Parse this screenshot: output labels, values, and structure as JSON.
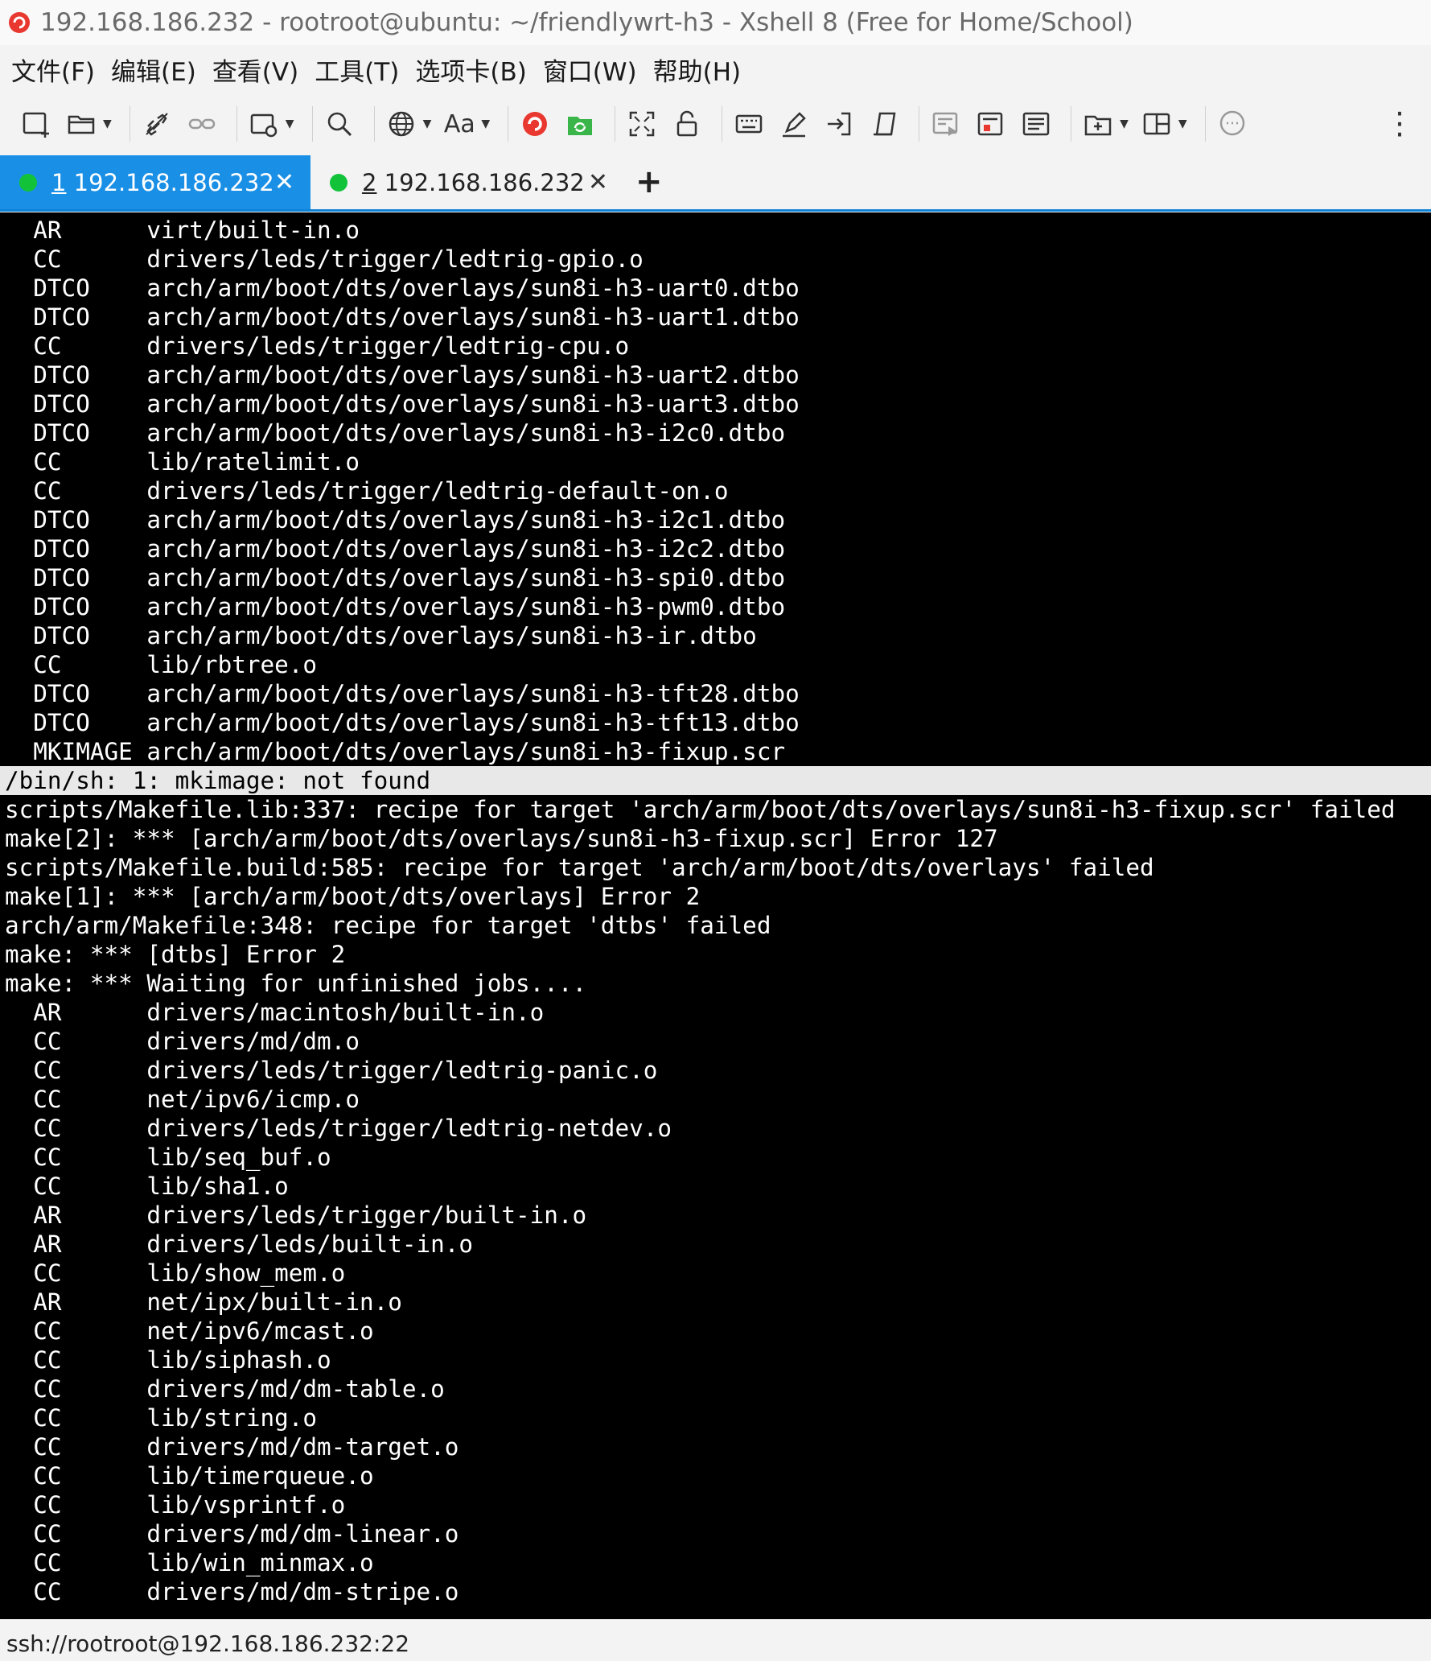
{
  "window": {
    "title": "192.168.186.232 - rootroot@ubuntu: ~/friendlywrt-h3 - Xshell 8 (Free for Home/School)"
  },
  "menu": [
    "文件(F)",
    "编辑(E)",
    "查看(V)",
    "工具(T)",
    "选项卡(B)",
    "窗口(W)",
    "帮助(H)"
  ],
  "toolbar": {
    "font_label": "Aa",
    "icons": [
      "new-session-icon",
      "open-folder-icon",
      "disconnect-icon",
      "reconnect-icon",
      "new-tab-icon",
      "find-icon",
      "globe-icon",
      "font-icon",
      "xshell-icon",
      "xftp-icon",
      "fullscreen-icon",
      "lock-icon",
      "keyboard-icon",
      "highlight-icon",
      "transfer-icon",
      "script-icon",
      "compose-bar-icon",
      "compose-pane-icon",
      "quick-command-icon",
      "new-window-icon",
      "layout-icon",
      "chat-icon",
      "more-icon"
    ]
  },
  "tabs": [
    {
      "index": "1",
      "label": "192.168.186.232",
      "active": true,
      "status_color": "#12c33a"
    },
    {
      "index": "2",
      "label": "192.168.186.232",
      "active": false,
      "status_color": "#12c33a"
    }
  ],
  "terminal": {
    "lines": [
      "  AR      virt/built-in.o",
      "  CC      drivers/leds/trigger/ledtrig-gpio.o",
      "  DTCO    arch/arm/boot/dts/overlays/sun8i-h3-uart0.dtbo",
      "  DTCO    arch/arm/boot/dts/overlays/sun8i-h3-uart1.dtbo",
      "  CC      drivers/leds/trigger/ledtrig-cpu.o",
      "  DTCO    arch/arm/boot/dts/overlays/sun8i-h3-uart2.dtbo",
      "  DTCO    arch/arm/boot/dts/overlays/sun8i-h3-uart3.dtbo",
      "  DTCO    arch/arm/boot/dts/overlays/sun8i-h3-i2c0.dtbo",
      "  CC      lib/ratelimit.o",
      "  CC      drivers/leds/trigger/ledtrig-default-on.o",
      "  DTCO    arch/arm/boot/dts/overlays/sun8i-h3-i2c1.dtbo",
      "  DTCO    arch/arm/boot/dts/overlays/sun8i-h3-i2c2.dtbo",
      "  DTCO    arch/arm/boot/dts/overlays/sun8i-h3-spi0.dtbo",
      "  DTCO    arch/arm/boot/dts/overlays/sun8i-h3-pwm0.dtbo",
      "  DTCO    arch/arm/boot/dts/overlays/sun8i-h3-ir.dtbo",
      "  CC      lib/rbtree.o",
      "  DTCO    arch/arm/boot/dts/overlays/sun8i-h3-tft28.dtbo",
      "  DTCO    arch/arm/boot/dts/overlays/sun8i-h3-tft13.dtbo",
      "  MKIMAGE arch/arm/boot/dts/overlays/sun8i-h3-fixup.scr",
      "/bin/sh: 1: mkimage: not found",
      "scripts/Makefile.lib:337: recipe for target 'arch/arm/boot/dts/overlays/sun8i-h3-fixup.scr' failed",
      "make[2]: *** [arch/arm/boot/dts/overlays/sun8i-h3-fixup.scr] Error 127",
      "scripts/Makefile.build:585: recipe for target 'arch/arm/boot/dts/overlays' failed",
      "make[1]: *** [arch/arm/boot/dts/overlays] Error 2",
      "arch/arm/Makefile:348: recipe for target 'dtbs' failed",
      "make: *** [dtbs] Error 2",
      "make: *** Waiting for unfinished jobs....",
      "  AR      drivers/macintosh/built-in.o",
      "  CC      drivers/md/dm.o",
      "  CC      drivers/leds/trigger/ledtrig-panic.o",
      "  CC      net/ipv6/icmp.o",
      "  CC      drivers/leds/trigger/ledtrig-netdev.o",
      "  CC      lib/seq_buf.o",
      "  CC      lib/sha1.o",
      "  AR      drivers/leds/trigger/built-in.o",
      "  AR      drivers/leds/built-in.o",
      "  CC      lib/show_mem.o",
      "  AR      net/ipx/built-in.o",
      "  CC      net/ipv6/mcast.o",
      "  CC      lib/siphash.o",
      "  CC      drivers/md/dm-table.o",
      "  CC      lib/string.o",
      "  CC      drivers/md/dm-target.o",
      "  CC      lib/timerqueue.o",
      "  CC      lib/vsprintf.o",
      "  CC      drivers/md/dm-linear.o",
      "  CC      lib/win_minmax.o",
      "  CC      drivers/md/dm-stripe.o"
    ],
    "highlighted_line": 19
  },
  "status": {
    "connection": "ssh://rootroot@192.168.186.232:22"
  },
  "colors": {
    "tab_active": "#1a8fe6",
    "connected": "#12c33a",
    "terminal_bg": "#000000",
    "terminal_fg": "#ffffff"
  }
}
